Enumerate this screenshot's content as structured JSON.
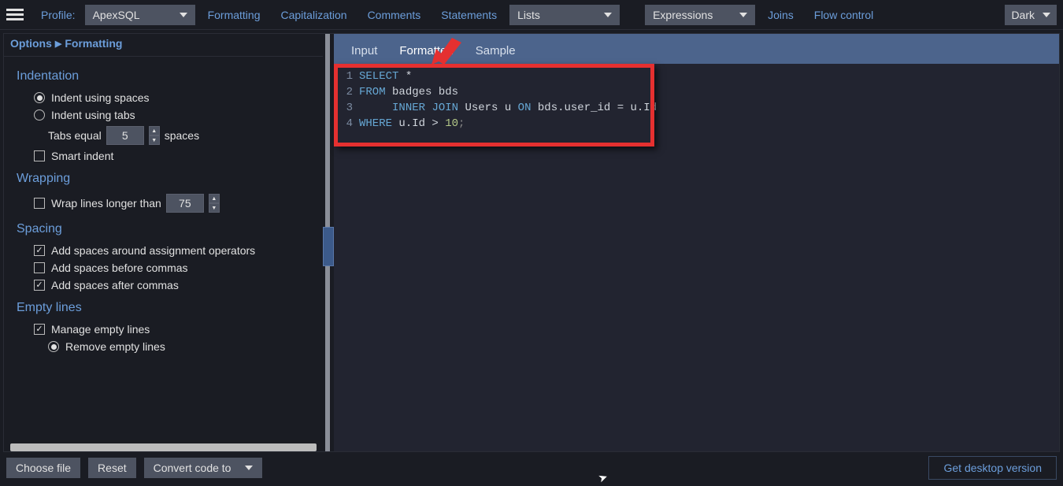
{
  "toolbar": {
    "profile_label": "Profile:",
    "profile_value": "ApexSQL",
    "links": {
      "formatting": "Formatting",
      "capitalization": "Capitalization",
      "comments": "Comments",
      "statements": "Statements",
      "joins": "Joins",
      "flow": "Flow control"
    },
    "dd_lists": "Lists",
    "dd_expressions": "Expressions",
    "theme": "Dark"
  },
  "crumb": {
    "root": "Options",
    "leaf": "Formatting"
  },
  "sections": {
    "indentation": {
      "title": "Indentation",
      "opt_spaces": "Indent using spaces",
      "opt_tabs": "Indent using tabs",
      "tabs_equal_pre": "Tabs equal",
      "tabs_equal_val": "5",
      "tabs_equal_post": "spaces",
      "smart_indent": "Smart indent"
    },
    "wrapping": {
      "title": "Wrapping",
      "wrap_label": "Wrap lines longer than",
      "wrap_val": "75"
    },
    "spacing": {
      "title": "Spacing",
      "assign": "Add spaces around assignment operators",
      "before_commas": "Add spaces before commas",
      "after_commas": "Add spaces after commas"
    },
    "empty": {
      "title": "Empty lines",
      "manage": "Manage empty lines",
      "remove": "Remove empty lines"
    }
  },
  "tabs": {
    "input": "Input",
    "formatted": "Formatted",
    "sample": "Sample"
  },
  "code": {
    "l1": {
      "n": "1",
      "kw": "SELECT",
      "rest": " *"
    },
    "l2": {
      "n": "2",
      "kw": "FROM",
      "rest": " badges bds"
    },
    "l3": {
      "n": "3",
      "pad": "     ",
      "kw1": "INNER",
      "kw2": "JOIN",
      "mid": " Users u ",
      "kw3": "ON",
      "rest": " bds.user_id = u.Id"
    },
    "l4": {
      "n": "4",
      "kw": "WHERE",
      "mid": " u.Id > ",
      "num": "10",
      "end": ";"
    }
  },
  "bottom": {
    "choose": "Choose file",
    "reset": "Reset",
    "convert": "Convert code to",
    "desktop": "Get desktop version"
  }
}
